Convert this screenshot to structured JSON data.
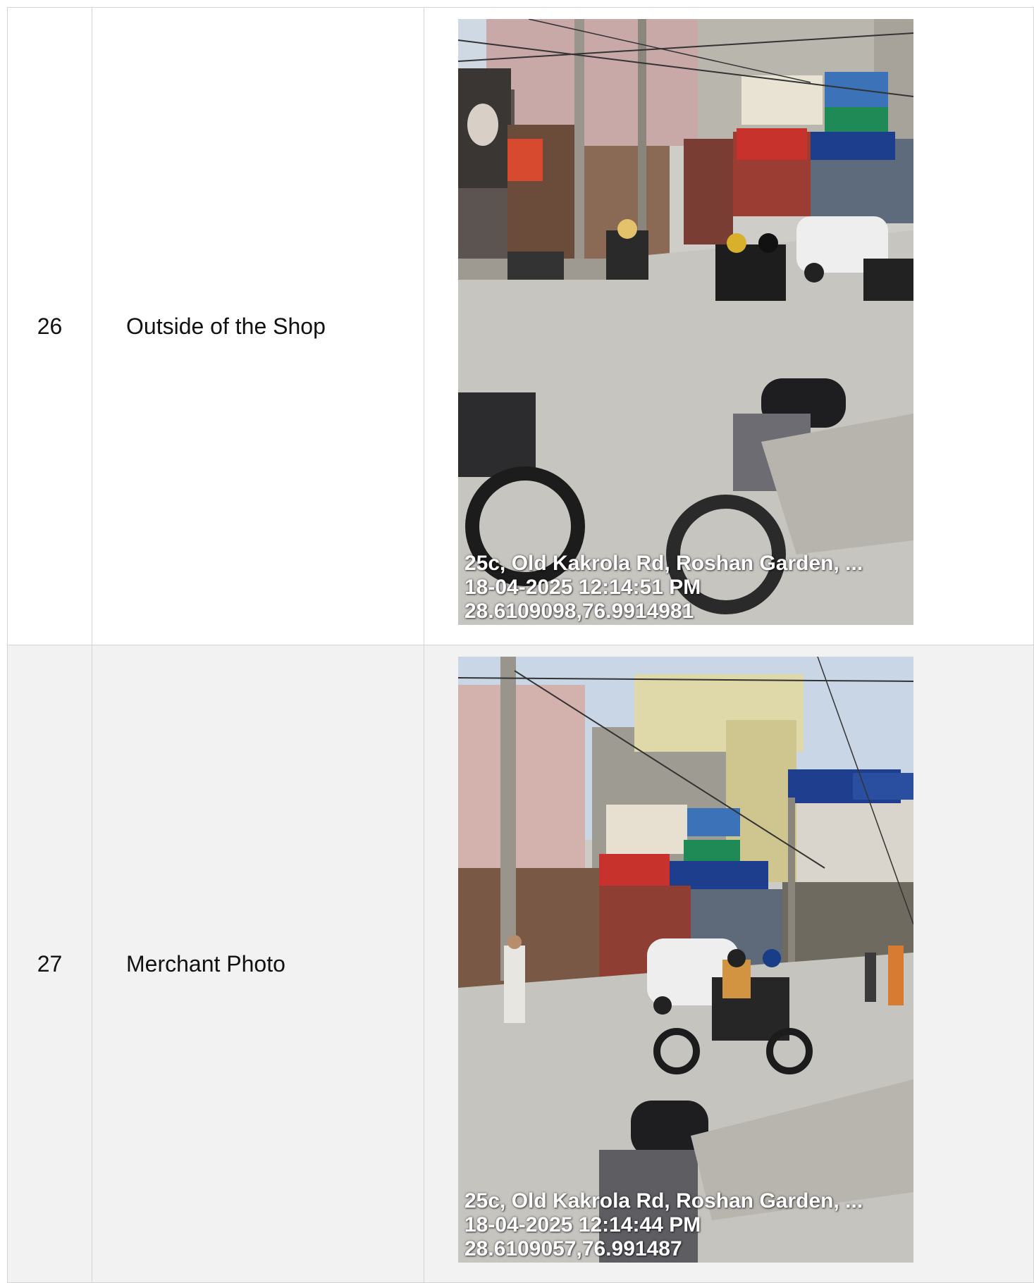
{
  "rows": [
    {
      "number": "26",
      "label": "Outside of the Shop",
      "photo": {
        "address": "25c, Old Kakrola Rd, Roshan Garden, ...",
        "datetime": "18-04-2025 12:14:51 PM",
        "coords": "28.6109098,76.9914981"
      }
    },
    {
      "number": "27",
      "label": "Merchant Photo",
      "photo": {
        "address": "25c, Old Kakrola Rd, Roshan Garden, ...",
        "datetime": "18-04-2025 12:14:44 PM",
        "coords": "28.6109057,76.991487"
      }
    }
  ],
  "colors": {
    "border": "#d4d4d4",
    "row_alt_bg": "#f2f2f2",
    "stamp_text": "#ffffff"
  }
}
